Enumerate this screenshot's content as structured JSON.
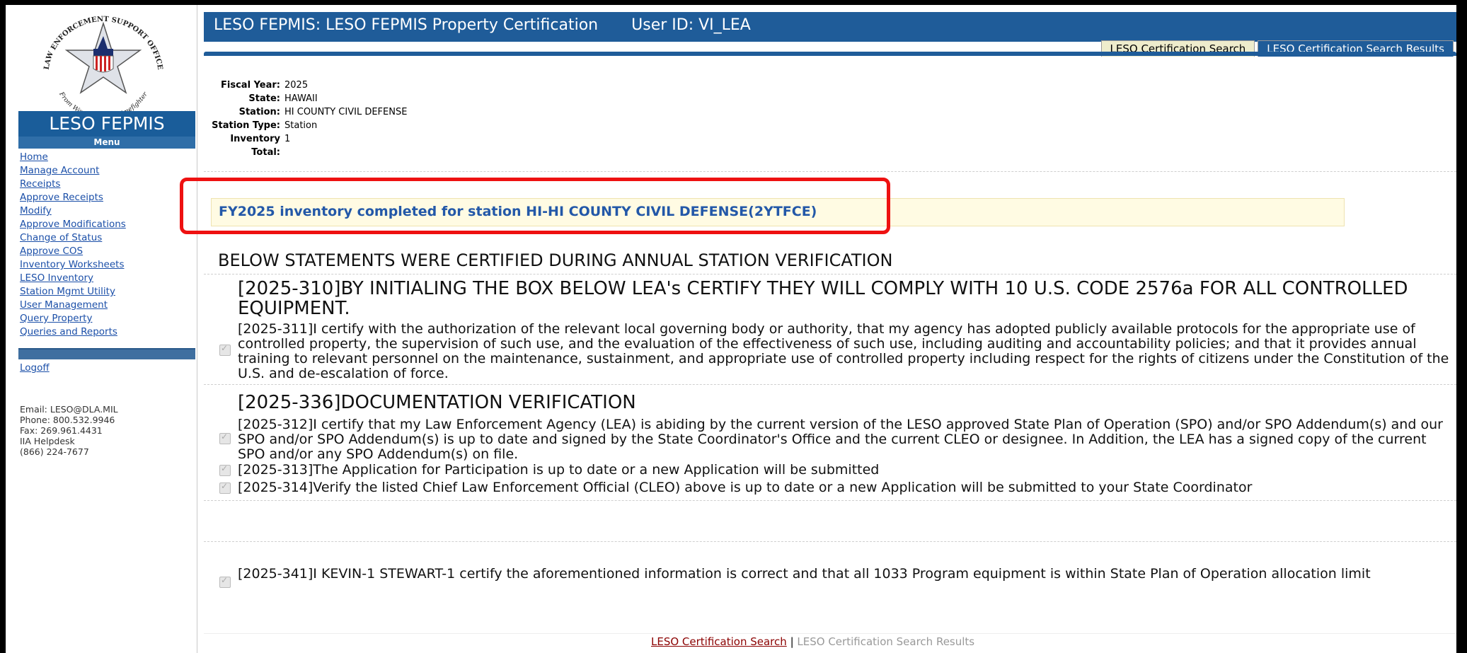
{
  "header": {
    "title": "LESO FEPMIS: LESO FEPMIS Property Certification",
    "user": "User ID: VI_LEA",
    "tabs": [
      {
        "label": "LESO Certification Search"
      },
      {
        "label": "LESO Certification Search Results"
      }
    ]
  },
  "sidebar": {
    "logo_text": {
      "top": "LAW ENFORCEMENT SUPPORT OFFICE",
      "bottom": "From Warfighter to Crimefighter"
    },
    "app_name": "LESO FEPMIS",
    "menu_header": "Menu",
    "menu": [
      "Home",
      "Manage Account",
      "Receipts",
      "Approve Receipts",
      "Modify",
      "Approve Modifications",
      "Change of Status",
      "Approve COS",
      "Inventory Worksheets",
      "LESO Inventory",
      "Station Mgmt Utility",
      "User Management",
      "Query Property",
      "Queries and Reports"
    ],
    "logoff": "Logoff",
    "contact": [
      "Email: LESO@DLA.MIL",
      "Phone: 800.532.9946",
      "Fax: 269.961.4431",
      "IIA Helpdesk",
      "(866) 224-7677"
    ]
  },
  "station_info": [
    {
      "label": "Fiscal Year:",
      "value": "2025"
    },
    {
      "label": "State:",
      "value": "HAWAII"
    },
    {
      "label": "Station:",
      "value": "HI COUNTY CIVIL DEFENSE"
    },
    {
      "label": "Station Type:",
      "value": "Station"
    },
    {
      "label": "Inventory Total:",
      "value": "1"
    }
  ],
  "completion_message": "FY2025 inventory completed for station HI-HI COUNTY CIVIL DEFENSE(2YTFCE)",
  "statements_header": "BELOW STATEMENTS WERE CERTIFIED DURING ANNUAL STATION VERIFICATION",
  "sections": [
    {
      "title": "[2025-310]BY INITIALING THE BOX BELOW LEA's CERTIFY THEY WILL COMPLY WITH 10 U.S. CODE 2576a FOR ALL CONTROLLED EQUIPMENT."
    },
    {
      "title": "[2025-336]DOCUMENTATION VERIFICATION"
    }
  ],
  "statements": [
    {
      "text": "[2025-311]I certify with the authorization of the relevant local governing body or authority, that my agency has adopted publicly available protocols for the appropriate use of controlled property, the supervision of such use, and the evaluation of the effectiveness of such use, including auditing and accountability policies; and that it provides annual training to relevant personnel on the maintenance, sustainment, and appropriate use of controlled property including respect for the rights of citizens under the Constitution of the U.S. and de-escalation of force.",
      "checked": true
    },
    {
      "text": "[2025-312]I certify that my Law Enforcement Agency (LEA) is abiding by the current version of the LESO approved State Plan of Operation (SPO) and/or SPO Addendum(s) and our SPO and/or SPO Addendum(s) is up to date and signed by the State Coordinator's Office and the current CLEO or designee. In Addition, the LEA has a signed copy of the current SPO and/or any SPO Addendum(s) on file.",
      "checked": true
    },
    {
      "text": "[2025-313]The Application for Participation is up to date or a new Application will be submitted",
      "checked": true
    },
    {
      "text": "[2025-314]Verify the listed Chief Law Enforcement Official (CLEO) above is up to date or a new Application will be submitted to your State Coordinator",
      "checked": true
    },
    {
      "text": "[2025-341]I KEVIN-1 STEWART-1 certify the aforementioned information is correct and that all 1033 Program equipment is within State Plan of Operation allocation limit",
      "checked": true
    }
  ],
  "footer": {
    "link_search": "LESO Certification Search",
    "separator": "|",
    "link_results": "LESO Certification Search Results"
  }
}
